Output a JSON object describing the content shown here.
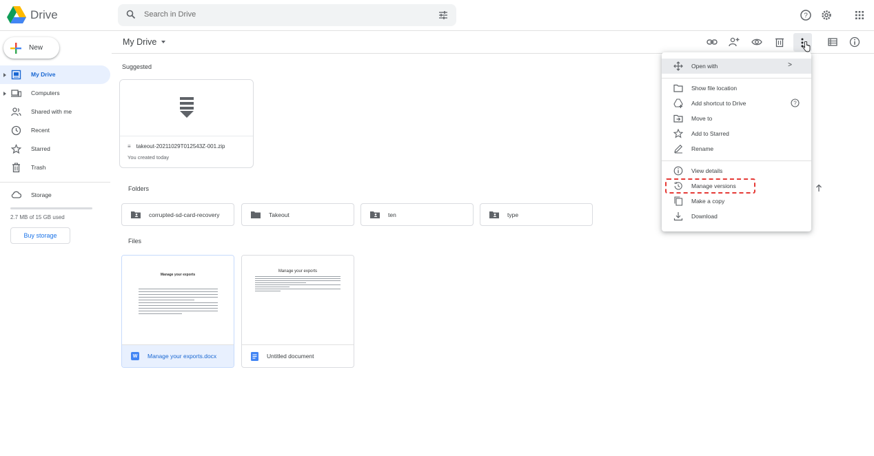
{
  "app": {
    "name": "Drive"
  },
  "search": {
    "placeholder": "Search in Drive"
  },
  "sidebar": {
    "new_label": "New",
    "items": [
      {
        "label": "My Drive",
        "icon": "my-drive-icon",
        "active": true
      },
      {
        "label": "Computers",
        "icon": "computers-icon"
      },
      {
        "label": "Shared with me",
        "icon": "shared-icon"
      },
      {
        "label": "Recent",
        "icon": "clock-icon"
      },
      {
        "label": "Starred",
        "icon": "star-icon"
      },
      {
        "label": "Trash",
        "icon": "trash-icon"
      }
    ],
    "storage_label": "Storage",
    "storage_used": "2.7 MB of 15 GB used",
    "storage_fraction": 0.0002,
    "buy_storage": "Buy storage"
  },
  "toolbar": {
    "title": "My Drive"
  },
  "main": {
    "suggested_label": "Suggested",
    "suggested": {
      "name": "takeout-20211029T012543Z-001.zip",
      "sub": "You created today"
    },
    "folders_label": "Folders",
    "folders": [
      "corrupted-sd-card-recovery",
      "Takeout",
      "ten",
      "type"
    ],
    "files_label": "Files",
    "files": [
      {
        "name": "Manage your exports.docx",
        "type": "word",
        "preview_title": "Manage your exports",
        "selected": true
      },
      {
        "name": "Untitled document",
        "type": "gdoc",
        "preview_title": "Manage your exports",
        "selected": false
      }
    ]
  },
  "menu": {
    "items": [
      {
        "label": "Open with",
        "icon": "move-arrows-icon"
      },
      {
        "label": "Show file location",
        "icon": "folder-icon"
      },
      {
        "label": "Add shortcut to Drive",
        "icon": "add-shortcut-icon"
      },
      {
        "label": "Move to",
        "icon": "move-to-icon"
      },
      {
        "label": "Add to Starred",
        "icon": "star-icon"
      },
      {
        "label": "Rename",
        "icon": "pencil-icon"
      },
      {
        "label": "View details",
        "icon": "info-icon"
      },
      {
        "label": "Manage versions",
        "icon": "history-icon"
      },
      {
        "label": "Make a copy",
        "icon": "copy-icon"
      },
      {
        "label": "Download",
        "icon": "download-icon"
      }
    ],
    "submenu_arrow": ">"
  },
  "colors": {
    "accent": "#1a73e8",
    "active_bg": "#e8f0fe",
    "highlight": "#e53935",
    "folder": "#5f6368"
  }
}
